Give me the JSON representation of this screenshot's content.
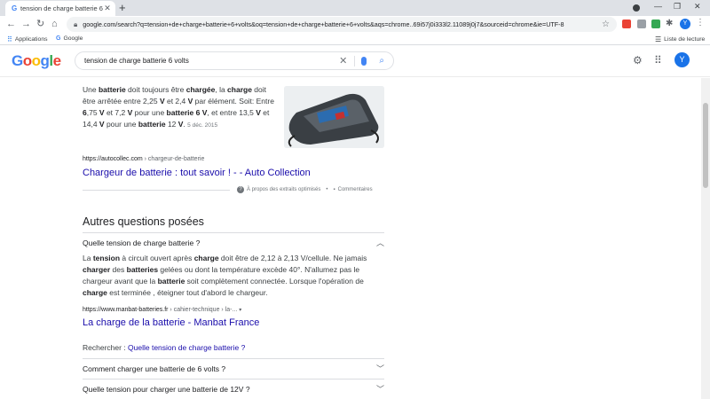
{
  "browser": {
    "tab_title": "tension de charge batterie 6 volts",
    "tab_favicon": "G",
    "new_tab": "+",
    "url": "google.com/search?q=tension+de+charge+batterie+6+volts&oq=tension+de+charge+batterie+6+volts&aqs=chrome..69i57j0i333l2.11089j0j7&sourceid=chrome&ie=UTF-8",
    "profile_initial": "Y",
    "bookmarks": [
      "Applications",
      "Google"
    ],
    "reading_list": "Liste de lecture"
  },
  "google": {
    "logo": [
      {
        "ch": "G",
        "color": "#4285f4"
      },
      {
        "ch": "o",
        "color": "#ea4335"
      },
      {
        "ch": "o",
        "color": "#fbbc05"
      },
      {
        "ch": "g",
        "color": "#4285f4"
      },
      {
        "ch": "l",
        "color": "#34a853"
      },
      {
        "ch": "e",
        "color": "#ea4335"
      }
    ],
    "query": "tension de charge batterie 6 volts",
    "avatar_initial": "Y"
  },
  "featured": {
    "date": "5 déc. 2015",
    "source_domain": "https://autocollec.com",
    "source_path": " › chargeur-de-batterie",
    "link_title": "Chargeur de batterie : tout savoir ! - - Auto Collection",
    "about_label": "À propos des extraits optimisés",
    "feedback_label": "Commentaires"
  },
  "paa": {
    "heading": "Autres questions posées",
    "q1": "Quelle tension de charge batterie ?",
    "source_domain": "https://www.manbat-batteries.fr",
    "source_path": " › cahier-technique › la-...",
    "link_title": "La charge de la batterie - Manbat France",
    "search_prefix": "Rechercher : ",
    "search_link": "Quelle tension de charge batterie ?",
    "q2": "Comment charger une batterie de 6 volts ?",
    "q3": "Quelle tension pour charger une batterie de 12V ?"
  },
  "icons": {
    "back": "arrow-left-icon",
    "forward": "arrow-right-icon",
    "reload": "reload-icon",
    "home": "home-icon",
    "lock": "lock-icon",
    "star": "star-icon",
    "settings": "gear-icon",
    "apps": "apps-grid-icon",
    "clear": "close-icon",
    "mic": "mic-icon",
    "search": "search-icon"
  }
}
